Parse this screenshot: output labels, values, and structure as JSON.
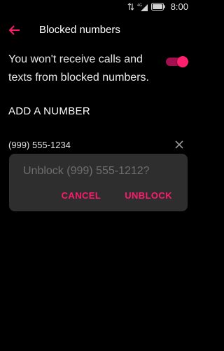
{
  "status_bar": {
    "time": "8:00",
    "icons": [
      "data-transfer-icon",
      "4g-signal-icon",
      "battery-icon"
    ]
  },
  "app_bar": {
    "back_icon": "arrow-back-icon",
    "title": "Blocked numbers"
  },
  "toggle_row": {
    "text": "You won't receive calls and texts from blocked numbers.",
    "enabled": true
  },
  "add_number_label": "ADD A NUMBER",
  "blocked_list": [
    {
      "number": "(999) 555-1234",
      "remove_icon": "close-icon"
    }
  ],
  "dialog": {
    "message": "Unblock (999) 555-1212?",
    "cancel_label": "CANCEL",
    "confirm_label": "UNBLOCK"
  },
  "colors": {
    "background": "#000000",
    "accent": "#ff1a6b",
    "dialog_background": "#2e2e2e",
    "dialog_message": "#6e6e6e"
  }
}
